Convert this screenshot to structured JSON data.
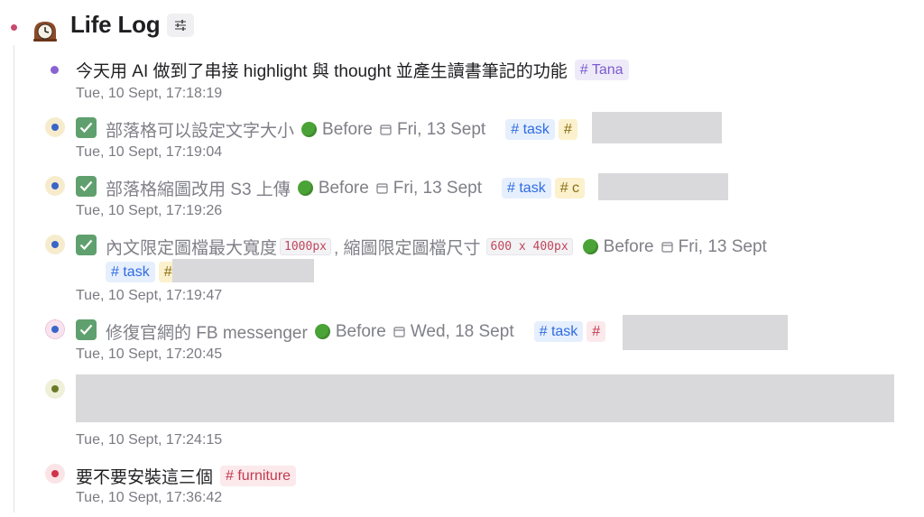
{
  "page": {
    "title": "Life Log",
    "title_icon": "mantel-clock-icon",
    "filter_icon": "sliders-icon"
  },
  "colors": {
    "done_green": "#5fa06e",
    "tag_blue": "#2f6ce0",
    "tag_purple": "#7b5bd0",
    "tag_red": "#c23a4f"
  },
  "entries": [
    {
      "text": "今天用 AI 做到了串接 highlight 與 thought 並產生讀書筆記的功能",
      "tag": "# Tana",
      "timestamp": "Tue, 10 Sept, 17:18:19"
    },
    {
      "text": "部落格可以設定文字大小",
      "status": "Before",
      "date": "Fri, 13 Sept",
      "tag": "# task",
      "tag2_visible": "#",
      "timestamp": "Tue, 10 Sept, 17:19:04",
      "checked": true
    },
    {
      "text": "部落格縮圖改用 S3 上傳",
      "status": "Before",
      "date": "Fri, 13 Sept",
      "tag": "# task",
      "tag2_visible": "# c",
      "timestamp": "Tue, 10 Sept, 17:19:26",
      "checked": true
    },
    {
      "text_a": "內文限定圖檔最大寬度",
      "code_a": "1000px",
      "text_b": ", 縮圖限定圖檔尺寸",
      "code_b": "600 x 400px",
      "status": "Before",
      "date": "Fri, 13 Sept",
      "tag": "# task",
      "tag2_visible": "#",
      "timestamp": "Tue, 10 Sept, 17:19:47",
      "checked": true
    },
    {
      "text": "修復官網的 FB messenger",
      "status": "Before",
      "date": "Wed, 18 Sept",
      "tag": "# task",
      "tag2_visible": "#",
      "timestamp": "Tue, 10 Sept, 17:20:45",
      "checked": true
    },
    {
      "timestamp": "Tue, 10 Sept, 17:24:15"
    },
    {
      "text": "要不要安裝這三個",
      "tag": "# furniture",
      "timestamp": "Tue, 10 Sept, 17:36:42"
    }
  ]
}
